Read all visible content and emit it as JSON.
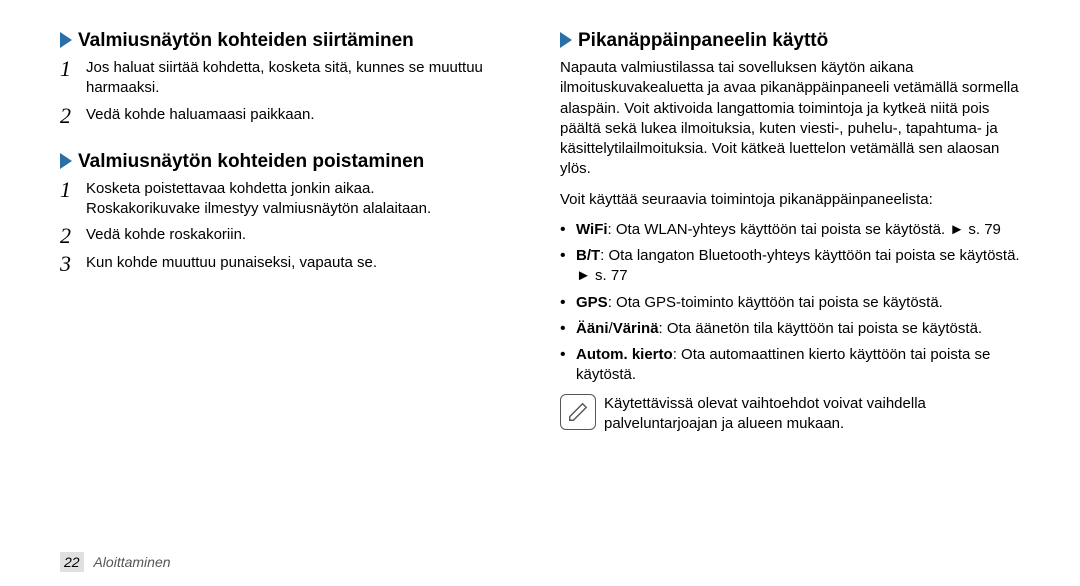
{
  "left": {
    "section1": {
      "title": "Valmiusnäytön kohteiden siirtäminen",
      "step1": "Jos haluat siirtää kohdetta, kosketa sitä, kunnes se muuttuu harmaaksi.",
      "step2": "Vedä kohde haluamaasi paikkaan."
    },
    "section2": {
      "title": "Valmiusnäytön kohteiden poistaminen",
      "step1": "Kosketa poistettavaa kohdetta jonkin aikaa.",
      "step1b": "Roskakorikuvake ilmestyy valmiusnäytön alalaitaan.",
      "step2": "Vedä kohde roskakoriin.",
      "step3": "Kun kohde muuttuu punaiseksi, vapauta se."
    }
  },
  "right": {
    "title": "Pikanäppäinpaneelin käyttö",
    "intro": "Napauta valmiustilassa tai sovelluksen käytön aikana ilmoituskuvakealuetta ja avaa pikanäppäinpaneeli vetämällä sormella alaspäin. Voit aktivoida langattomia toimintoja ja kytkeä niitä pois päältä sekä lukea ilmoituksia, kuten viesti-, puhelu-, tapahtuma- ja käsittelytilailmoituksia. Voit kätkeä luettelon vetämällä sen alaosan ylös.",
    "lead": "Voit käyttää seuraavia toimintoja pikanäppäinpaneelista:",
    "bullets": {
      "wifi_label": "WiFi",
      "wifi_text": ": Ota WLAN-yhteys käyttöön tai poista se käytöstä. ► s. 79",
      "bt_label": "B/T",
      "bt_text": ": Ota langaton Bluetooth-yhteys käyttöön tai poista se käytöstä. ► s. 77",
      "gps_label": "GPS",
      "gps_text": ": Ota GPS-toiminto käyttöön tai poista se käytöstä.",
      "sound_label": "Ääni",
      "vibra_label": "Värinä",
      "sound_text": ": Ota äänetön tila käyttöön tai poista se käytöstä.",
      "auto_label": "Autom. kierto",
      "auto_text": ": Ota automaattinen kierto käyttöön tai poista se käytöstä."
    },
    "note": "Käytettävissä olevat vaihtoehdot voivat vaihdella palveluntarjoajan ja alueen mukaan."
  },
  "footer": {
    "page": "22",
    "section": "Aloittaminen"
  }
}
